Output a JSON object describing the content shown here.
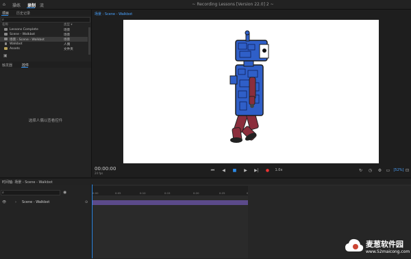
{
  "topbar": {
    "nav": [
      "操练",
      "录制",
      "流"
    ],
    "window_title": "~ Recording Lessons [Version 22.0] 2 ~"
  },
  "leftpanel": {
    "tabs": [
      "项目",
      "历史记录"
    ],
    "columns": {
      "name": "名称",
      "type": "类型 ▾"
    },
    "rows": [
      {
        "name": "Lessons Complete",
        "type": "场景"
      },
      {
        "name": "Scene - Walkbot",
        "type": "场景"
      },
      {
        "name": "场景 - Scene - Walkbot",
        "type": "场景"
      },
      {
        "name": "Walkbot",
        "type": "人偶"
      },
      {
        "name": "Assets",
        "type": "文件夹"
      }
    ],
    "bottom_tabs": [
      "触发器",
      "控件"
    ],
    "empty_message": "选择人偶以查看控件"
  },
  "stage": {
    "breadcrumb": "场景 : Scene - Walkbot",
    "timecode": "00:00:00",
    "fps": "24 fps",
    "speed": "1.0x",
    "zoom": "[52%]"
  },
  "timeline": {
    "title": "时间轴: 场景 - Scene - Walkbot",
    "ticks": [
      "0:00",
      "0:05",
      "0:10",
      "0:15",
      "0:20",
      "0:25",
      "0:30",
      "0:35",
      "0:40",
      "0:45",
      "0:50",
      "0:55"
    ],
    "track_name": "Scene - Walkbot"
  },
  "watermark": {
    "brand": "麦葱软件园",
    "url": "www.52maicong.com"
  }
}
